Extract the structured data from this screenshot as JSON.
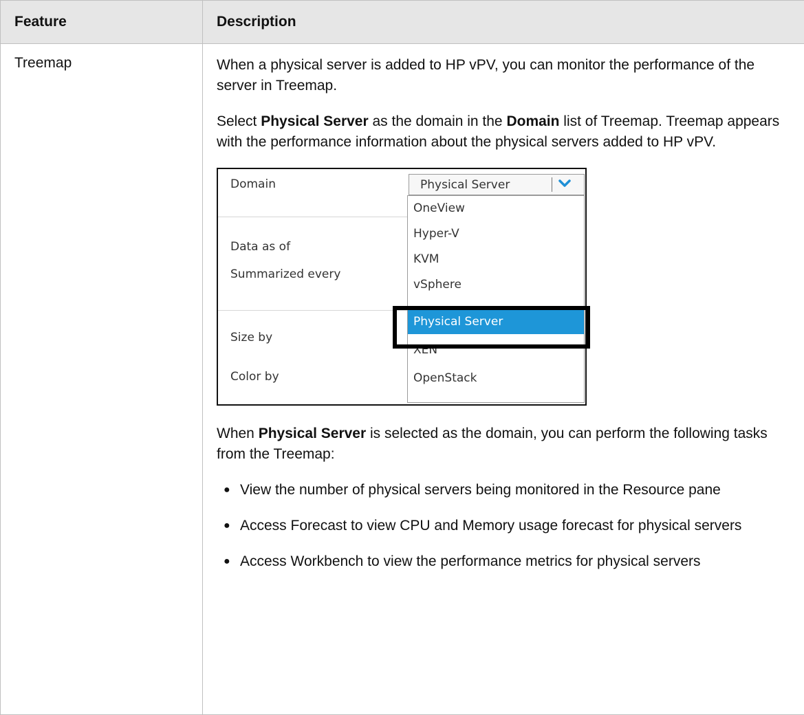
{
  "table": {
    "headers": [
      "Feature",
      "Description"
    ],
    "feature": "Treemap",
    "intro": "When a physical server is added to HP vPV, you can monitor the performance of the server in Treemap.",
    "select_para": {
      "p1": "Select ",
      "b1": "Physical Server",
      "p2": " as the domain in the ",
      "b2": "Domain",
      "p3": " list of Treemap. Treemap appears with the performance information about the physical servers added to HP vPV."
    },
    "when_para": {
      "p1": "When ",
      "b1": "Physical Server",
      "p2": " is selected as the domain, you can perform the following tasks from the Treemap:"
    },
    "tasks": [
      "View the number of physical servers being monitored in the Resource pane",
      "Access Forecast to view CPU and Memory usage forecast for physical servers",
      "Access Workbench to view the performance metrics for physical servers"
    ]
  },
  "screenshot": {
    "labels": [
      "Domain",
      "Data as of",
      "Summarized every",
      "Size by",
      "Color by"
    ],
    "dropdown": {
      "selected": "Physical Server",
      "options": [
        "OneView",
        "Hyper-V",
        "KVM",
        "vSphere",
        "Physical Server",
        "XEN",
        "OpenStack"
      ],
      "highlighted_option": "Physical Server",
      "highlight_color": "#1e96d8",
      "chevron_color": "#1e8fd6"
    }
  }
}
